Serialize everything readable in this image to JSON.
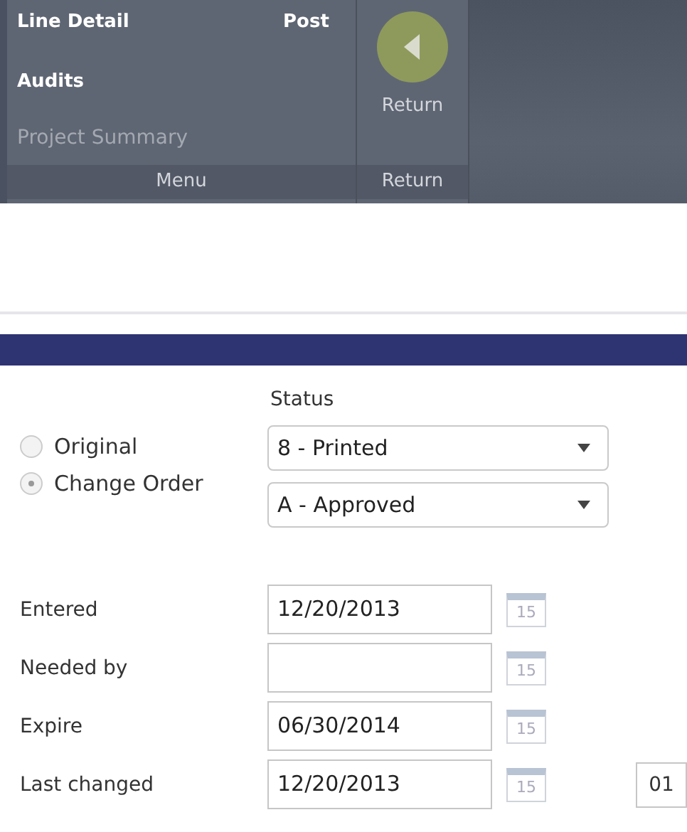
{
  "ribbon": {
    "groups": [
      {
        "kind": "menu",
        "label": "Menu",
        "items": [
          {
            "label": "Line Detail",
            "disabled": false
          },
          {
            "label": "Post",
            "disabled": false
          },
          {
            "label": "Audits",
            "disabled": false
          },
          {
            "label": "Project Summary",
            "disabled": true
          }
        ]
      },
      {
        "kind": "return",
        "label": "Return",
        "button": "Return"
      }
    ]
  },
  "form": {
    "type_options": [
      {
        "label": "Original",
        "selected": false
      },
      {
        "label": "Change Order",
        "selected": true
      }
    ],
    "status_label": "Status",
    "status_fields": [
      "8 - Printed",
      "A - Approved"
    ],
    "dates": [
      {
        "label": "Entered",
        "value": "12/20/2013",
        "calendar": "15"
      },
      {
        "label": "Needed by",
        "calendar": "15"
      },
      {
        "label": "Expire",
        "value": "06/30/2014",
        "calendar": "15"
      },
      {
        "label": "Last changed",
        "value": "12/20/2013",
        "calendar": "15",
        "extra": "01"
      }
    ]
  }
}
